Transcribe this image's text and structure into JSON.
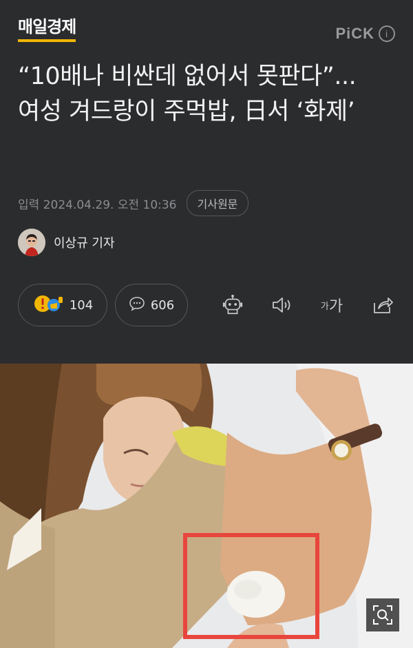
{
  "header": {
    "logo": "매일경제",
    "pick_label": "PiCK",
    "info_icon": "i"
  },
  "article": {
    "headline": "“10배나 비싼데 없어서 못판다”...여성 겨드랑이 주먹밥, 日서 ‘화제’",
    "date": "입력 2024.04.29. 오전 10:36",
    "original_button": "기사원문",
    "reporter": "이상규 기자"
  },
  "actions": {
    "reaction_count": "104",
    "comment_count": "606",
    "font_label_small": "가",
    "font_label_large": "가"
  },
  "icons": {
    "reaction": "reaction-emoji-icon",
    "comment": "speech-bubble-icon",
    "summary": "robot-icon",
    "tts": "speaker-icon",
    "font": "font-size-icon",
    "share": "share-icon",
    "zoom": "image-zoom-icon",
    "info": "info-icon"
  },
  "colors": {
    "background": "#2b2c2e",
    "logo_underline": "#f2b705",
    "highlight_box": "#e8463d"
  }
}
